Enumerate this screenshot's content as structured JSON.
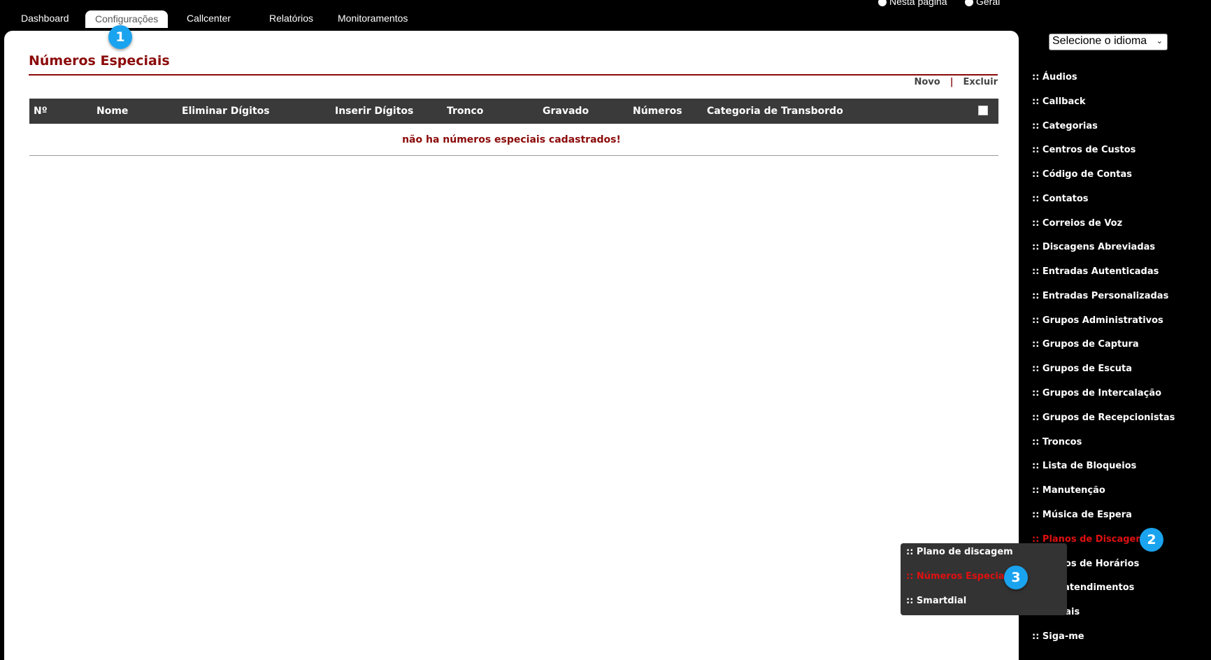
{
  "tabs": [
    "Dashboard",
    "Configurações",
    "Callcenter",
    "Relatórios",
    "Monitoramentos"
  ],
  "active_tab": "Configurações",
  "radio_options": [
    "Nesta página",
    "Geral"
  ],
  "page_title": "Números Especiais",
  "actions": {
    "new": "Novo",
    "separator": "|",
    "delete": "Excluir"
  },
  "table": {
    "columns": [
      "Nº",
      "Nome",
      "Eliminar Dígitos",
      "Inserir Dígitos",
      "Tronco",
      "Gravado",
      "Números",
      "Categoria de Transbordo"
    ],
    "empty_message": "não ha números especiais cadastrados!"
  },
  "language_select": "Selecione o idioma",
  "sidebar": {
    "items": [
      ":: Áudios",
      ":: Callback",
      ":: Categorias",
      ":: Centros de Custos",
      ":: Código de Contas",
      ":: Contatos",
      ":: Correios de Voz",
      ":: Discagens Abreviadas",
      ":: Entradas Autenticadas",
      ":: Entradas Personalizadas",
      ":: Grupos Administrativos",
      ":: Grupos de Captura",
      ":: Grupos de Escuta",
      ":: Grupos de Intercalação",
      ":: Grupos de Recepcionistas",
      ":: Troncos",
      ":: Lista de Bloqueios",
      ":: Manutenção",
      ":: Música de Espera",
      ":: Planos de Discagem",
      ":: Planos de Horários",
      ":: Pré-atendimentos",
      ":: Ramais",
      ":: Siga-me"
    ],
    "active_item": ":: Planos de Discagem"
  },
  "submenu": {
    "items": [
      ":: Plano de discagem",
      ":: Números Especiais",
      ":: Smartdial"
    ],
    "active_item": ":: Números Especiais"
  },
  "markers": [
    "1",
    "2",
    "3"
  ],
  "colors": {
    "accent": "#8b0a0a",
    "active_menu": "#e01010",
    "marker": "#1aa3ef",
    "header_bg": "#3a3a3a"
  }
}
